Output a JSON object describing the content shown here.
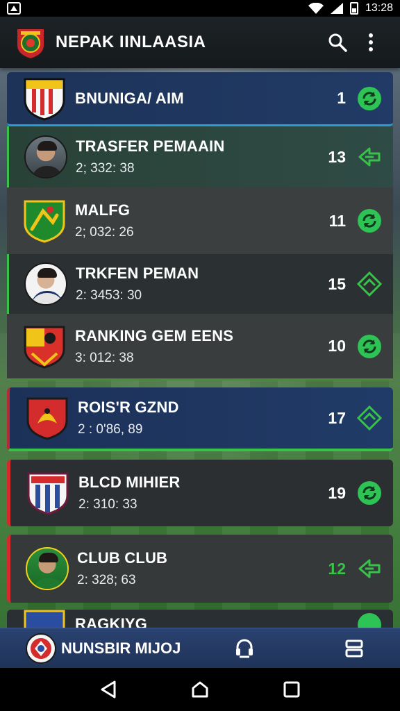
{
  "status_bar": {
    "time": "13:28"
  },
  "app_bar": {
    "title": "NEPAK IINLAASIA",
    "search_icon": "search-icon",
    "menu_icon": "more-vert-icon"
  },
  "list": {
    "items": [
      {
        "name": "BNUNIGA/ AIM",
        "time": "",
        "number": "1",
        "crest": "crest-red-white-stripes",
        "action_icon": "refresh-icon",
        "accent": "#1f3b66"
      },
      {
        "name": "TRASFER PEMAAIN",
        "time": "2; 332: 38",
        "number": "13",
        "crest": "player-avatar",
        "action_icon": "swap-arrows-icon",
        "accent": "#2f4a44"
      },
      {
        "name": "MALFG",
        "time": "2; 032: 26",
        "number": "11",
        "crest": "crest-green-gold",
        "action_icon": "refresh-icon",
        "accent": "#3b3f3f"
      },
      {
        "name": "TRKFEN PEMAN",
        "time": "2: 3453: 30",
        "number": "15",
        "crest": "player-avatar-light",
        "action_icon": "stadium-icon",
        "accent": "#2b3033"
      },
      {
        "name": "RANKING GEM EENS",
        "time": "3: 012: 38",
        "number": "10",
        "crest": "crest-red-yellow",
        "action_icon": "refresh-icon",
        "accent": "#393d3d"
      },
      {
        "name": "ROIS'R GZND",
        "time": "2 : 0'86, 89",
        "number": "17",
        "crest": "crest-red-phoenix",
        "action_icon": "stadium-icon",
        "accent": "#1f3560"
      },
      {
        "name": "BLCD MIHIER",
        "time": "2: 310: 33",
        "number": "19",
        "crest": "crest-blue-white-stripes",
        "action_icon": "refresh-icon",
        "accent": "#2b2f31"
      },
      {
        "name": "CLUB CLUB",
        "time": "2: 328; 63",
        "number": "12",
        "crest": "player-avatar-green",
        "action_icon": "swap-arrows-icon",
        "accent": "#353939"
      },
      {
        "name": "RAGKIYG",
        "time": "",
        "number": "",
        "crest": "crest-blue",
        "action_icon": "refresh-icon",
        "accent": "#2a2f33"
      }
    ]
  },
  "bottom_nav": {
    "brand_label": "NUNSBIR MIJOJ",
    "brand_icon": "club-crest-icon",
    "item2_icon": "headset-icon",
    "item3_icon": "layers-icon"
  },
  "colors": {
    "accent_green": "#38c24a",
    "accent_blue": "#2a9cd8",
    "accent_red": "#d42c2c",
    "appbar": "#1a1f22",
    "bottom_nav": "#233a63"
  }
}
